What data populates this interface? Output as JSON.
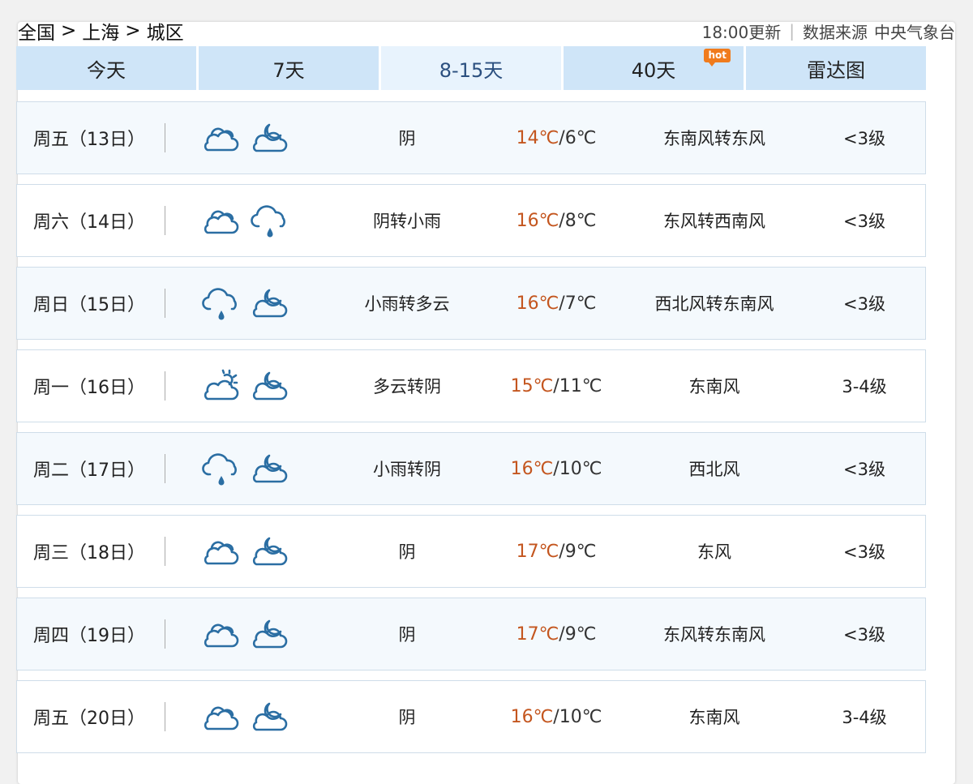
{
  "breadcrumb": {
    "country": "全国",
    "city": "上海",
    "district": "城区",
    "separator": ">"
  },
  "meta": {
    "update_time": "18:00更新",
    "source_label": "数据来源",
    "source_name": "中央气象台"
  },
  "tabs": [
    {
      "label": "今天"
    },
    {
      "label": "7天"
    },
    {
      "label": "8-15天",
      "active": true
    },
    {
      "label": "40天",
      "badge": "hot"
    },
    {
      "label": "雷达图"
    }
  ],
  "colors": {
    "tab_bg": "#cfe5f8",
    "tab_active_bg": "#e8f3fd",
    "high_temp": "#c4561f",
    "hot_badge": "#f07b1d",
    "icon_blue": "#2b6ea3"
  },
  "rows": [
    {
      "date": "周五（13日）",
      "icon_day": "overcast-icon",
      "icon_night": "moon-cloud-icon",
      "desc": "阴",
      "hi": "14℃",
      "lo": "/6℃",
      "wind": "东南风转东风",
      "level": "<3级"
    },
    {
      "date": "周六（14日）",
      "icon_day": "overcast-icon",
      "icon_night": "light-rain-icon",
      "desc": "阴转小雨",
      "hi": "16℃",
      "lo": "/8℃",
      "wind": "东风转西南风",
      "level": "<3级"
    },
    {
      "date": "周日（15日）",
      "icon_day": "light-rain-icon",
      "icon_night": "moon-cloud-icon",
      "desc": "小雨转多云",
      "hi": "16℃",
      "lo": "/7℃",
      "wind": "西北风转东南风",
      "level": "<3级"
    },
    {
      "date": "周一（16日）",
      "icon_day": "sun-cloud-icon",
      "icon_night": "moon-cloud-icon",
      "desc": "多云转阴",
      "hi": "15℃",
      "lo": "/11℃",
      "wind": "东南风",
      "level": "3-4级"
    },
    {
      "date": "周二（17日）",
      "icon_day": "light-rain-icon",
      "icon_night": "moon-cloud-icon",
      "desc": "小雨转阴",
      "hi": "16℃",
      "lo": "/10℃",
      "wind": "西北风",
      "level": "<3级"
    },
    {
      "date": "周三（18日）",
      "icon_day": "overcast-icon",
      "icon_night": "moon-cloud-icon",
      "desc": "阴",
      "hi": "17℃",
      "lo": "/9℃",
      "wind": "东风",
      "level": "<3级"
    },
    {
      "date": "周四（19日）",
      "icon_day": "overcast-icon",
      "icon_night": "moon-cloud-icon",
      "desc": "阴",
      "hi": "17℃",
      "lo": "/9℃",
      "wind": "东风转东南风",
      "level": "<3级"
    },
    {
      "date": "周五（20日）",
      "icon_day": "overcast-icon",
      "icon_night": "moon-cloud-icon",
      "desc": "阴",
      "hi": "16℃",
      "lo": "/10℃",
      "wind": "东南风",
      "level": "3-4级"
    }
  ]
}
